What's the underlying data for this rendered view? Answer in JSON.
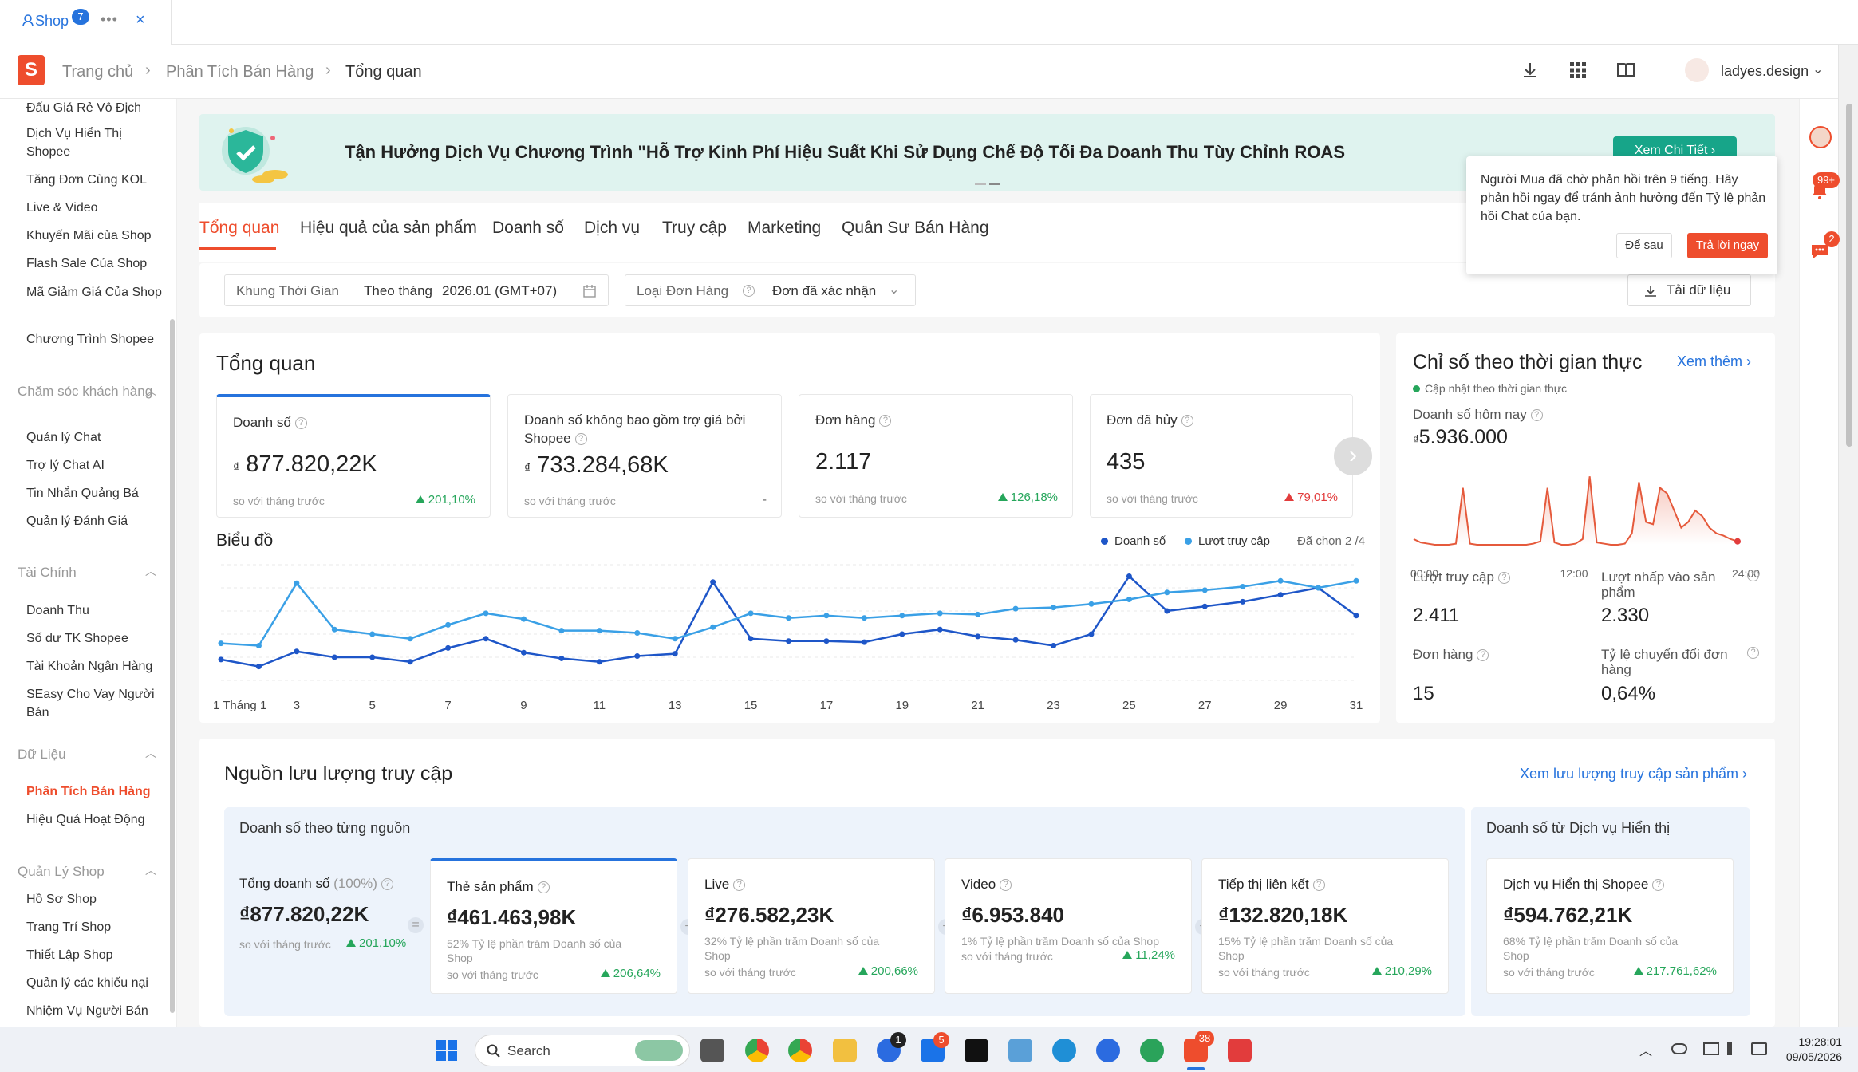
{
  "browser_tab": {
    "label": "Shop",
    "badge": "7",
    "more": "•••",
    "close": "×"
  },
  "header": {
    "logo": "S",
    "breadcrumb": [
      "Trang chủ",
      "Phân Tích Bán Hàng",
      "Tổng quan"
    ],
    "username": "ladyes.design",
    "icons": [
      "download-icon",
      "apps-grid-icon",
      "book-icon",
      "avatar",
      "chevron-down-icon"
    ]
  },
  "sidebar": {
    "groups": [
      {
        "title": "",
        "items": [
          "Đấu Giá Rẻ Vô Địch",
          "Dịch Vụ Hiển Thị Shopee",
          "Tăng Đơn Cùng KOL",
          "Live & Video",
          "Khuyến Mãi của Shop",
          "Flash Sale Của Shop",
          "Mã Giảm Giá Của Shop",
          "Chương Trình Shopee"
        ]
      },
      {
        "title": "Chăm sóc khách hàng",
        "items": [
          "Quản lý Chat",
          "Trợ lý Chat AI",
          "Tin Nhắn Quảng Bá",
          "Quản lý Đánh Giá"
        ]
      },
      {
        "title": "Tài Chính",
        "items": [
          "Doanh Thu",
          "Số dư TK Shopee",
          "Tài Khoản Ngân Hàng",
          "SEasy Cho Vay Người Bán"
        ]
      },
      {
        "title": "Dữ Liệu",
        "items": [
          "Phân Tích Bán Hàng",
          "Hiệu Quả Hoạt Động"
        ]
      },
      {
        "title": "Quản Lý Shop",
        "items": [
          "Hồ Sơ Shop",
          "Trang Trí Shop",
          "Thiết Lập Shop",
          "Quản lý các khiếu nại",
          "Nhiệm Vụ Người Bán"
        ]
      }
    ],
    "active": "Phân Tích Bán Hàng"
  },
  "banner": {
    "text": "Tận Hưởng Dịch Vụ Chương Trình \"Hỗ Trợ Kinh Phí Hiệu Suất Khi Sử Dụng Chế Độ Tối Đa Doanh Thu Tùy Chỉnh ROAS",
    "button": "Xem Chi Tiết ›"
  },
  "tabs": [
    "Tổng quan",
    "Hiệu quả của sản phẩm",
    "Doanh số",
    "Dịch vụ",
    "Truy cập",
    "Marketing",
    "Quân Sư Bán Hàng"
  ],
  "filters": {
    "period_label": "Khung Thời Gian",
    "period_mode": "Theo tháng",
    "period_value": "2026.01 (GMT+07)",
    "order_type_label": "Loại Đơn Hàng",
    "order_type_value": "Đơn đã xác nhận",
    "download_label": "Tải dữ liệu"
  },
  "overview": {
    "title": "Tổng quan",
    "metrics": [
      {
        "label": "Doanh số",
        "value": "877.820,22K",
        "currency": "₫",
        "compare": "so với tháng trước",
        "change": "201,10%",
        "direction": "up"
      },
      {
        "label": "Doanh số không bao gồm trợ giá bởi Shopee",
        "value": "733.284,68K",
        "currency": "₫",
        "compare": "so với tháng trước",
        "change": "-",
        "direction": "none"
      },
      {
        "label": "Đơn hàng",
        "value": "2.117",
        "currency": "",
        "compare": "so với tháng trước",
        "change": "126,18%",
        "direction": "up"
      },
      {
        "label": "Đơn đã hủy",
        "value": "435",
        "currency": "",
        "compare": "so với tháng trước",
        "change": "79,01%",
        "direction": "up-bad"
      }
    ],
    "chart_title": "Biểu đồ",
    "chart_selected": "Đã chọn 2 /4"
  },
  "chart_data": [
    {
      "type": "line",
      "title": "Biểu đồ",
      "x": [
        1,
        2,
        3,
        4,
        5,
        6,
        7,
        8,
        9,
        10,
        11,
        12,
        13,
        14,
        15,
        16,
        17,
        18,
        19,
        20,
        21,
        22,
        23,
        24,
        25,
        26,
        27,
        28,
        29,
        30,
        31
      ],
      "x_tick_labels": [
        "1 Tháng 1",
        "3",
        "5",
        "7",
        "9",
        "11",
        "13",
        "15",
        "17",
        "19",
        "21",
        "23",
        "25",
        "27",
        "29",
        "31"
      ],
      "series": [
        {
          "name": "Doanh số",
          "color": "#1e56c8",
          "values": [
            18,
            12,
            25,
            20,
            20,
            16,
            28,
            36,
            24,
            19,
            16,
            21,
            23,
            85,
            36,
            34,
            34,
            33,
            40,
            44,
            38,
            35,
            30,
            40,
            90,
            60,
            64,
            68,
            74,
            80,
            56
          ]
        },
        {
          "name": "Lượt truy cập",
          "color": "#3aa0e6",
          "values": [
            32,
            30,
            84,
            44,
            40,
            36,
            48,
            58,
            53,
            43,
            43,
            41,
            36,
            46,
            58,
            54,
            56,
            54,
            56,
            58,
            57,
            62,
            63,
            66,
            70,
            76,
            78,
            81,
            86,
            80,
            86
          ]
        }
      ],
      "ylim": [
        0,
        100
      ],
      "legend": "top-right",
      "grid": true
    },
    {
      "type": "area",
      "title": "Doanh số hôm nay",
      "x_tick_labels": [
        "00:00",
        "12:00",
        "24:00"
      ],
      "series": [
        {
          "name": "Doanh số hôm nay",
          "color": "#e55a3c",
          "values": [
            5,
            2,
            1,
            0,
            0,
            0,
            1,
            50,
            1,
            0,
            0,
            0,
            0,
            0,
            0,
            0,
            0,
            1,
            3,
            50,
            2,
            0,
            0,
            1,
            5,
            60,
            2,
            1,
            0,
            0,
            1,
            10,
            55,
            20,
            18,
            50,
            45,
            30,
            15,
            20,
            30,
            25,
            15,
            10,
            8,
            5,
            3
          ]
        }
      ],
      "ylim": [
        0,
        70
      ]
    }
  ],
  "realtime": {
    "title": "Chỉ số theo thời gian thực",
    "more": "Xem thêm ›",
    "subtitle": "Cập nhật theo thời gian thực",
    "sales_label": "Doanh số hôm nay",
    "sales_value": "5.936.000",
    "currency": "₫",
    "stats": [
      {
        "label": "Lượt truy cập",
        "value": "2.411"
      },
      {
        "label": "Lượt nhấp vào sản phẩm",
        "value": "2.330"
      },
      {
        "label": "Đơn hàng",
        "value": "15"
      },
      {
        "label": "Tỷ lệ chuyển đổi đơn hàng",
        "value": "0,64%"
      }
    ]
  },
  "traffic": {
    "title": "Nguồn lưu lượng truy cập",
    "link": "Xem lưu lượng truy cập sản phẩm ›",
    "sources_title": "Doanh số theo từng nguồn",
    "display_title": "Doanh số từ Dịch vụ Hiển thị",
    "total": {
      "label": "Tổng doanh số",
      "label_suffix": "(100%)",
      "value": "₫877.820,22K",
      "compare": "so với tháng trước",
      "change": "201,10%"
    },
    "sources": [
      {
        "label": "Thẻ sản phẩm",
        "value": "₫461.463,98K",
        "pct": "52% Tỷ lệ phần trăm Doanh số của Shop",
        "compare": "so với tháng trước",
        "change": "206,64%"
      },
      {
        "label": "Live",
        "value": "₫276.582,23K",
        "pct": "32% Tỷ lệ phần trăm Doanh số của Shop",
        "compare": "so với tháng trước",
        "change": "200,66%"
      },
      {
        "label": "Video",
        "value": "₫6.953.840",
        "pct": "1% Tỷ lệ phần trăm Doanh số của Shop",
        "compare": "so với tháng trước",
        "change": "11,24%"
      },
      {
        "label": "Tiếp thị liên kết",
        "value": "₫132.820,18K",
        "pct": "15% Tỷ lệ phần trăm Doanh số của Shop",
        "compare": "so với tháng trước",
        "change": "210,29%"
      }
    ],
    "display": {
      "label": "Dịch vụ Hiển thị Shopee",
      "value": "₫594.762,21K",
      "pct": "68% Tỷ lệ phần trăm Doanh số của Shop",
      "compare": "so với tháng trước",
      "change": "217.761,62%"
    }
  },
  "popup": {
    "message": "Người Mua đã chờ phản hồi trên 9 tiếng. Hãy phản hồi ngay để tránh ảnh hưởng đến Tỷ lệ phản hồi Chat của bạn.",
    "later": "Để sau",
    "reply": "Trả lời ngay"
  },
  "rail": {
    "badge1": "99+",
    "badge2": "2"
  },
  "taskbar": {
    "search": "Search",
    "time": "19:28:01",
    "date": "09/05/2026",
    "badge_chrome": "1",
    "badge_zalo": "5",
    "badge_shopee": "38"
  },
  "colors": {
    "brand": "#ee4d2d",
    "primary": "#2673dd",
    "up": "#26a65b",
    "down": "#e23c3c"
  }
}
